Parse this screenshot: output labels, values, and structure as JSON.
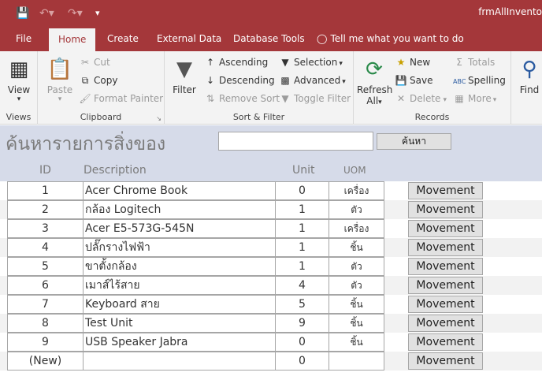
{
  "window": {
    "title": "frmAllInvento"
  },
  "tabs": [
    {
      "label": "File"
    },
    {
      "label": "Home"
    },
    {
      "label": "Create"
    },
    {
      "label": "External Data"
    },
    {
      "label": "Database Tools"
    }
  ],
  "tell_me": "Tell me what you want to do",
  "ribbon": {
    "views": {
      "view": "View",
      "group": "Views"
    },
    "clipboard": {
      "paste": "Paste",
      "cut": "Cut",
      "copy": "Copy",
      "format_painter": "Format Painter",
      "group": "Clipboard"
    },
    "sort_filter": {
      "filter": "Filter",
      "ascending": "Ascending",
      "descending": "Descending",
      "remove_sort": "Remove Sort",
      "selection": "Selection",
      "advanced": "Advanced",
      "toggle_filter": "Toggle Filter",
      "group": "Sort & Filter"
    },
    "records": {
      "refresh_line1": "Refresh",
      "refresh_line2": "All",
      "new": "New",
      "save": "Save",
      "delete": "Delete",
      "totals": "Totals",
      "spelling": "Spelling",
      "more": "More",
      "group": "Records"
    },
    "find": {
      "find": "Find"
    }
  },
  "form": {
    "title": "ค้นหารายการสิ่งของ",
    "search_value": "",
    "search_button": "ค้นหา",
    "columns": {
      "id": "ID",
      "description": "Description",
      "unit": "Unit",
      "uom": "UOM"
    },
    "rows": [
      {
        "id": "1",
        "description": "Acer Chrome Book",
        "unit": "0",
        "uom": "เครื่อง",
        "button": "Movement"
      },
      {
        "id": "2",
        "description": "กล้อง Logitech",
        "unit": "1",
        "uom": "ตัว",
        "button": "Movement"
      },
      {
        "id": "3",
        "description": "Acer E5-573G-545N",
        "unit": "1",
        "uom": "เครื่อง",
        "button": "Movement"
      },
      {
        "id": "4",
        "description": "ปลั๊กรางไฟฟ้า",
        "unit": "1",
        "uom": "ชิ้น",
        "button": "Movement"
      },
      {
        "id": "5",
        "description": "ขาตั้งกล้อง",
        "unit": "1",
        "uom": "ตัว",
        "button": "Movement"
      },
      {
        "id": "6",
        "description": "เมาส์ไร้สาย",
        "unit": "4",
        "uom": "ตัว",
        "button": "Movement"
      },
      {
        "id": "7",
        "description": "Keyboard สาย",
        "unit": "5",
        "uom": "ชิ้น",
        "button": "Movement"
      },
      {
        "id": "8",
        "description": "Test Unit",
        "unit": "9",
        "uom": "ชิ้น",
        "button": "Movement"
      },
      {
        "id": "9",
        "description": "USB Speaker Jabra",
        "unit": "0",
        "uom": "ชิ้น",
        "button": "Movement"
      },
      {
        "id": "(New)",
        "description": "",
        "unit": "0",
        "uom": "",
        "button": "Movement"
      }
    ]
  }
}
